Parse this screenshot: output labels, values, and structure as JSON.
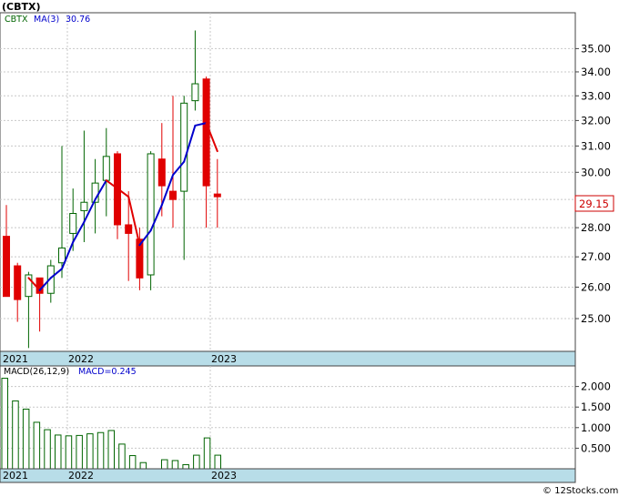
{
  "title": "(CBTX)",
  "price_legend": {
    "symbol": "CBTX",
    "ma_label": "MA(3)",
    "ma_value": "30.76"
  },
  "macd_legend": {
    "label": "MACD(26,12,9)",
    "value_label": "MACD=0.245"
  },
  "last_price_label": "29.15",
  "footer": "© 12Stocks.com",
  "colors": {
    "up": "#006400",
    "down": "#e00000",
    "ma_up": "#0000cc",
    "ma_down": "#e00000",
    "axis_band": "#b8dde8"
  },
  "chart_data": [
    {
      "type": "candlestick",
      "name": "price",
      "y_ticks": [
        25.0,
        26.0,
        27.0,
        28.0,
        29.0,
        30.0,
        31.0,
        32.0,
        33.0,
        34.0,
        35.0
      ],
      "y_tick_labels": [
        "25.00",
        "26.00",
        "27.00",
        "28.00",
        "29.00",
        "30.00",
        "31.00",
        "32.00",
        "33.00",
        "34.00",
        "35.00"
      ],
      "y_scale": "log",
      "ylim": [
        24.0,
        36.6
      ],
      "x_tick_labels": [
        {
          "label": "2021",
          "index": 0
        },
        {
          "label": "2022",
          "index": 7
        },
        {
          "label": "2023",
          "index": 19
        }
      ],
      "last_price": 29.15,
      "candles": [
        {
          "o": 27.7,
          "h": 28.8,
          "l": 26.1,
          "c": 25.7
        },
        {
          "o": 26.7,
          "h": 26.8,
          "l": 24.9,
          "c": 25.6
        },
        {
          "o": 25.7,
          "h": 26.5,
          "l": 24.1,
          "c": 26.4
        },
        {
          "o": 26.3,
          "h": 26.3,
          "l": 24.6,
          "c": 25.8
        },
        {
          "o": 25.8,
          "h": 26.9,
          "l": 25.5,
          "c": 26.7
        },
        {
          "o": 26.8,
          "h": 31.0,
          "l": 26.3,
          "c": 27.3
        },
        {
          "o": 27.8,
          "h": 29.4,
          "l": 27.2,
          "c": 28.5
        },
        {
          "o": 28.6,
          "h": 31.6,
          "l": 27.5,
          "c": 28.9
        },
        {
          "o": 28.9,
          "h": 30.5,
          "l": 27.8,
          "c": 29.6
        },
        {
          "o": 29.7,
          "h": 31.7,
          "l": 28.4,
          "c": 30.6
        },
        {
          "o": 30.7,
          "h": 30.8,
          "l": 27.6,
          "c": 28.1
        },
        {
          "o": 28.1,
          "h": 29.3,
          "l": 26.2,
          "c": 27.8
        },
        {
          "o": 27.6,
          "h": 28.0,
          "l": 25.9,
          "c": 26.3
        },
        {
          "o": 26.4,
          "h": 30.8,
          "l": 25.9,
          "c": 30.7
        },
        {
          "o": 30.5,
          "h": 31.9,
          "l": 28.4,
          "c": 29.5
        },
        {
          "o": 29.3,
          "h": 33.0,
          "l": 28.0,
          "c": 29.0
        },
        {
          "o": 29.3,
          "h": 33.0,
          "l": 26.9,
          "c": 32.7
        },
        {
          "o": 32.8,
          "h": 35.8,
          "l": 32.4,
          "c": 33.5
        },
        {
          "o": 33.7,
          "h": 33.8,
          "l": 28.0,
          "c": 29.5
        },
        {
          "o": 29.2,
          "h": 30.5,
          "l": 28.0,
          "c": 29.1
        }
      ],
      "ma3": [
        null,
        null,
        26.3,
        25.9,
        26.3,
        26.6,
        27.5,
        28.2,
        29.0,
        29.7,
        29.4,
        29.1,
        27.4,
        27.9,
        28.8,
        29.9,
        30.4,
        31.8,
        31.9,
        30.8
      ]
    },
    {
      "type": "bar",
      "name": "macd-histogram",
      "y_ticks": [
        0.5,
        1.0,
        1.5,
        2.0
      ],
      "y_tick_labels": [
        "0.500",
        "1.000",
        "1.500",
        "2.000"
      ],
      "ylim": [
        0,
        2.5
      ],
      "x_tick_labels": [
        {
          "label": "2021",
          "index": 0
        },
        {
          "label": "2022",
          "index": 7
        },
        {
          "label": "2023",
          "index": 19
        }
      ],
      "values": [
        2.2,
        1.65,
        1.45,
        1.13,
        0.95,
        0.82,
        0.8,
        0.81,
        0.85,
        0.88,
        0.93,
        0.6,
        0.32,
        0.15,
        0.0,
        0.22,
        0.2,
        0.1,
        0.33,
        0.75,
        0.33
      ],
      "direction": [
        "up",
        "up",
        "up",
        "up",
        "up",
        "up",
        "up",
        "up",
        "up",
        "up",
        "up",
        "up",
        "up",
        "up",
        "up",
        "up",
        "up",
        "up",
        "up",
        "up",
        "up"
      ]
    }
  ]
}
